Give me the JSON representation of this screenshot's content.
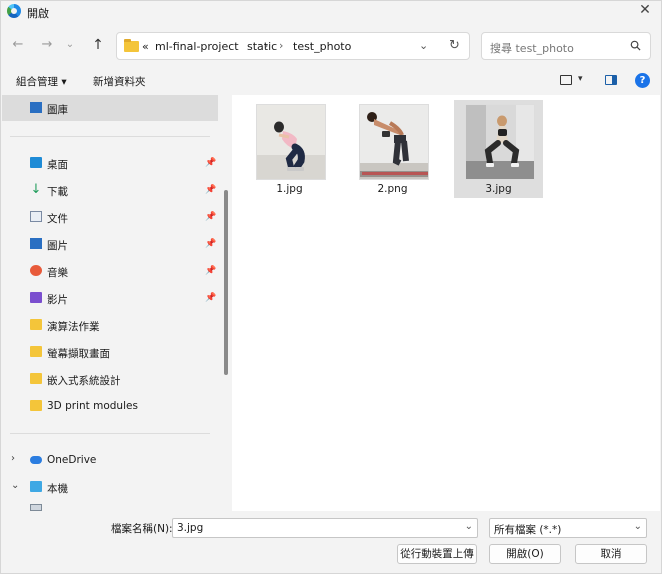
{
  "window": {
    "title": "開啟",
    "close_icon": "close-icon"
  },
  "nav": {
    "back_icon": "arrow-left-icon",
    "forward_icon": "arrow-right-icon",
    "recent_icon": "chevron-down-icon",
    "up_icon": "arrow-up-icon",
    "breadcrumb": {
      "prefix": "«",
      "items": [
        "ml-final-project",
        "static",
        "test_photo"
      ],
      "separator": "›"
    },
    "search_placeholder": "搜尋 test_photo"
  },
  "toolbar": {
    "organize_label": "組合管理 ▾",
    "new_folder_label": "新增資料夾"
  },
  "sidebar": {
    "top": {
      "label": "圖庫",
      "icon": "gallery-icon"
    },
    "quick_access": [
      {
        "label": "桌面",
        "icon": "desktop-icon",
        "pinned": true
      },
      {
        "label": "下載",
        "icon": "download-icon",
        "pinned": true
      },
      {
        "label": "文件",
        "icon": "document-icon",
        "pinned": true
      },
      {
        "label": "圖片",
        "icon": "pictures-icon",
        "pinned": true
      },
      {
        "label": "音樂",
        "icon": "music-icon",
        "pinned": true
      },
      {
        "label": "影片",
        "icon": "videos-icon",
        "pinned": true
      },
      {
        "label": "演算法作業",
        "icon": "folder-icon",
        "pinned": false
      },
      {
        "label": "螢幕擷取畫面",
        "icon": "folder-icon",
        "pinned": false
      },
      {
        "label": "嵌入式系統設計",
        "icon": "folder-icon",
        "pinned": false
      },
      {
        "label": "3D print modules",
        "icon": "folder-icon",
        "pinned": false
      }
    ],
    "locations": [
      {
        "label": "OneDrive",
        "icon": "cloud-icon",
        "expanded": false
      },
      {
        "label": "本機",
        "icon": "computer-icon",
        "expanded": true
      }
    ]
  },
  "files": [
    {
      "name": "1.jpg",
      "selected": false
    },
    {
      "name": "2.png",
      "selected": false
    },
    {
      "name": "3.jpg",
      "selected": true
    }
  ],
  "bottom": {
    "filename_label": "檔案名稱(N):",
    "filename_value": "3.jpg",
    "filter_value": "所有檔案 (*.*)",
    "upload_button": "從行動裝置上傳",
    "open_button": "開啟(O)",
    "cancel_button": "取消"
  },
  "colors": {
    "selection": "#dcdcdc",
    "accent": "#1a73e8",
    "folder": "#f4c53a"
  }
}
